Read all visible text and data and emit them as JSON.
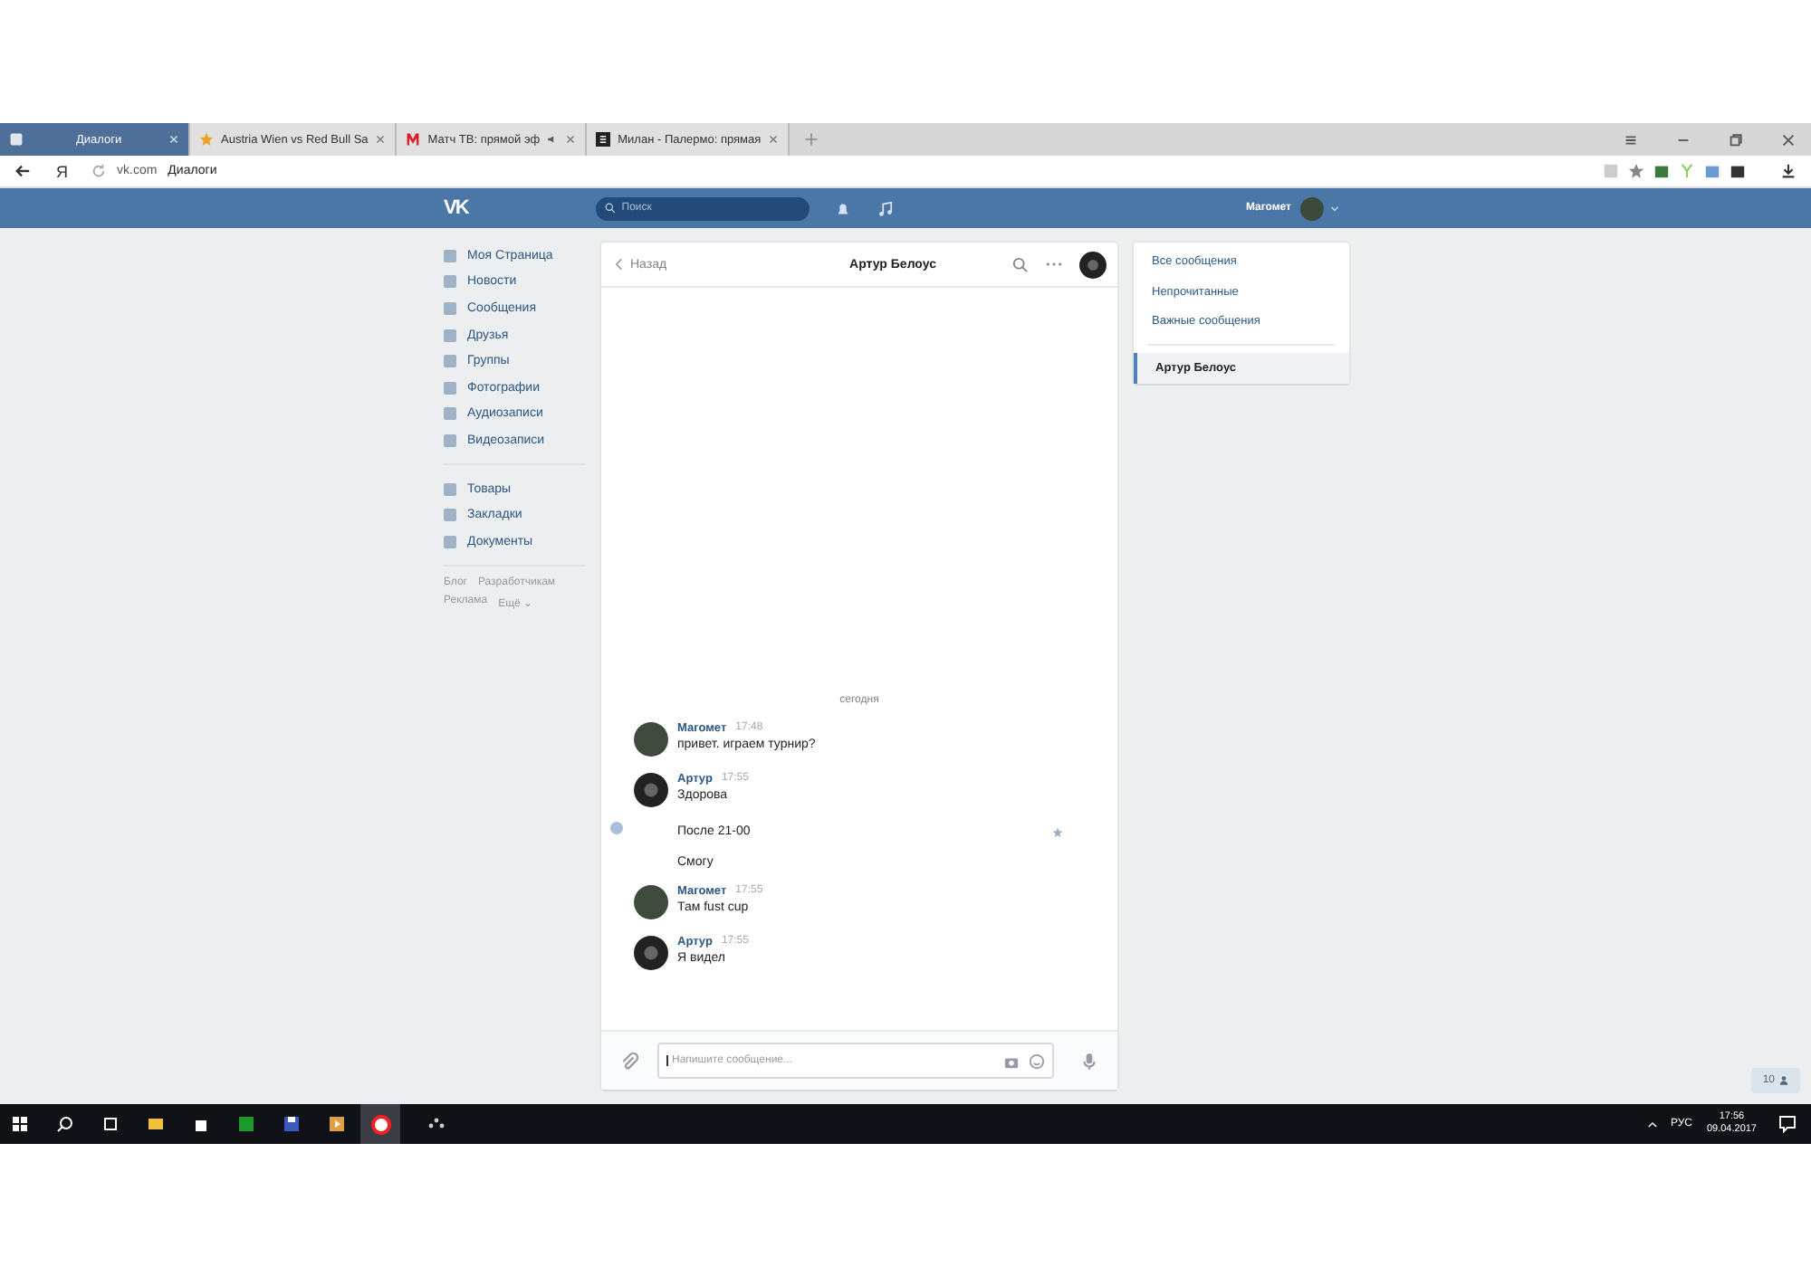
{
  "browser": {
    "tabs": [
      {
        "label": "Диалоги",
        "selected": true
      },
      {
        "label": "Austria Wien vs Red Bull Sa",
        "selected": false
      },
      {
        "label": "Матч ТВ: прямой эф",
        "selected": false
      },
      {
        "label": "Милан - Палермо: прямая",
        "selected": false
      }
    ],
    "logo": "Я",
    "address": {
      "domain": "vk.com",
      "title": "Диалоги"
    }
  },
  "header": {
    "logo": "VK",
    "search_placeholder": "Поиск",
    "user_name": "Магомет"
  },
  "sidebar": {
    "groups": [
      [
        {
          "label": "Моя Страница"
        },
        {
          "label": "Новости"
        },
        {
          "label": "Сообщения"
        },
        {
          "label": "Друзья"
        },
        {
          "label": "Группы"
        },
        {
          "label": "Фотографии"
        },
        {
          "label": "Аудиозаписи"
        },
        {
          "label": "Видеозаписи"
        }
      ],
      [
        {
          "label": "Товары"
        },
        {
          "label": "Закладки"
        },
        {
          "label": "Документы"
        }
      ]
    ],
    "footer_links": [
      [
        "Блог",
        "Разработчикам"
      ],
      [
        "Реклама",
        "Ещё ⌄"
      ]
    ]
  },
  "chat": {
    "back": "Назад",
    "title": "Артур Белоус",
    "date_divider": "сегодня",
    "messages": [
      {
        "author": "Магомет",
        "time": "17:48",
        "kind": "photo",
        "lines": [
          {
            "text": "привет. играем турнир?",
            "highlighted": false
          }
        ]
      },
      {
        "author": "Артур",
        "time": "17:55",
        "kind": "logo",
        "lines": [
          {
            "text": "Здорова",
            "highlighted": false
          },
          {
            "text": "После 21-00",
            "highlighted": true
          },
          {
            "text": "Смогу",
            "highlighted": false
          }
        ]
      },
      {
        "author": "Магомет",
        "time": "17:55",
        "kind": "photo",
        "lines": [
          {
            "text": "Там fust cup",
            "highlighted": false
          }
        ]
      },
      {
        "author": "Артур",
        "time": "17:55",
        "kind": "logo",
        "lines": [
          {
            "text": "Я видел",
            "highlighted": false
          }
        ]
      }
    ],
    "input_placeholder": "Напишите сообщение..."
  },
  "filters": [
    {
      "label": "Все сообщения",
      "selected": false
    },
    {
      "label": "Непрочитанные",
      "selected": false
    },
    {
      "label": "Важные сообщения",
      "selected": false
    }
  ],
  "conversations": [
    {
      "label": "Артур Белоус",
      "selected": true
    }
  ],
  "online_count": "10",
  "taskbar": {
    "language": "РУС",
    "time": "17:56",
    "date": "09.04.2017"
  }
}
